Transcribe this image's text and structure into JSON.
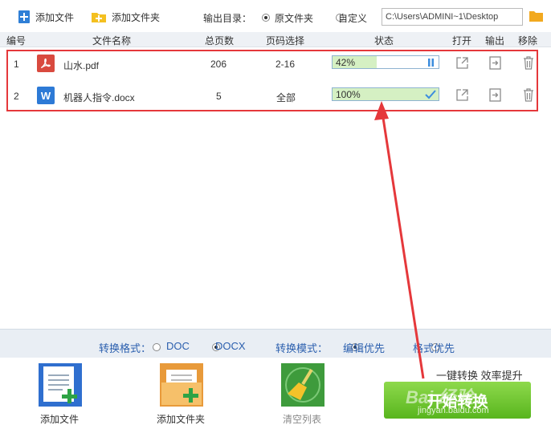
{
  "toolbar": {
    "add_file": "添加文件",
    "add_folder": "添加文件夹",
    "output_dir_label": "输出目录：",
    "source_folder": "原文件夹",
    "custom": "自定义",
    "path": "C:\\Users\\ADMINI~1\\Desktop"
  },
  "table": {
    "headers": {
      "index": "编号",
      "filename": "文件名称",
      "pages": "总页数",
      "page_select": "页码选择",
      "status": "状态",
      "open": "打开",
      "output": "输出",
      "remove": "移除"
    },
    "rows": [
      {
        "index": "1",
        "icon": "pdf-file-icon",
        "name": "山水.pdf",
        "pages": "206",
        "range": "2-16",
        "progress_text": "42%",
        "progress": 0.42,
        "state_icon": "pause-icon"
      },
      {
        "index": "2",
        "icon": "word-file-icon",
        "name": "机器人指令.docx",
        "pages": "5",
        "range": "全部",
        "progress_text": "100%",
        "progress": 1.0,
        "state_icon": "check-icon"
      }
    ]
  },
  "options": {
    "format_label": "转换格式：",
    "format_doc": "DOC",
    "format_docx": "DOCX",
    "mode_label": "转换模式：",
    "mode_edit": "编辑优先",
    "mode_format": "格式优先"
  },
  "footer": {
    "add_file": "添加文件",
    "add_folder": "添加文件夹",
    "clear_list": "清空列表",
    "slogan": "一键转换  效率提升",
    "convert": "开始转换"
  },
  "watermark": {
    "brand": "Bai 经验",
    "url": "jingyan.baidu.com"
  },
  "colors": {
    "accent_blue": "#2b5fae",
    "progress_fill": "#d5f0c3",
    "highlight_red": "#e5383b",
    "convert_green": "#6cc52f"
  }
}
